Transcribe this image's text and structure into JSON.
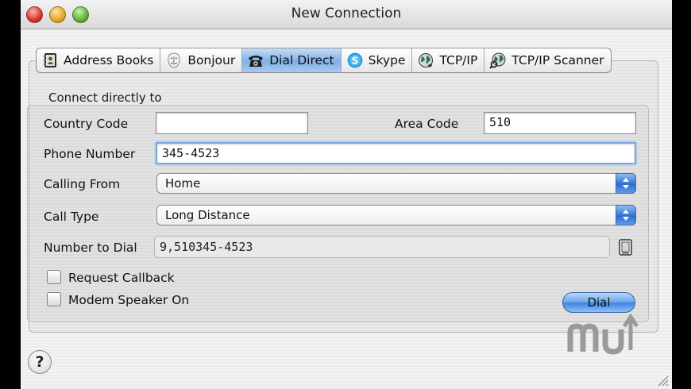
{
  "window": {
    "title": "New Connection"
  },
  "tabs": [
    {
      "label": "Address Books",
      "icon": "address-book-icon"
    },
    {
      "label": "Bonjour",
      "icon": "bonjour-icon"
    },
    {
      "label": "Dial Direct",
      "icon": "telephone-icon",
      "active": true
    },
    {
      "label": "Skype",
      "icon": "skype-icon"
    },
    {
      "label": "TCP/IP",
      "icon": "globe-icon"
    },
    {
      "label": "TCP/IP Scanner",
      "icon": "globe-scanner-icon"
    }
  ],
  "form": {
    "group_title": "Connect directly to",
    "country_code": {
      "label": "Country Code",
      "value": ""
    },
    "area_code": {
      "label": "Area Code",
      "value": "510"
    },
    "phone_number": {
      "label": "Phone Number",
      "value": "345-4523"
    },
    "calling_from": {
      "label": "Calling From",
      "value": "Home"
    },
    "call_type": {
      "label": "Call Type",
      "value": "Long Distance"
    },
    "number_to_dial": {
      "label": "Number to Dial",
      "value": "9,510345-4523"
    },
    "request_callback": {
      "label": "Request Callback",
      "checked": false
    },
    "modem_speaker": {
      "label": "Modem Speaker On",
      "checked": false
    },
    "dial_button": "Dial"
  },
  "help_button": "?",
  "colors": {
    "accent": "#3e80df",
    "active_tab": "#7fb0e8"
  }
}
